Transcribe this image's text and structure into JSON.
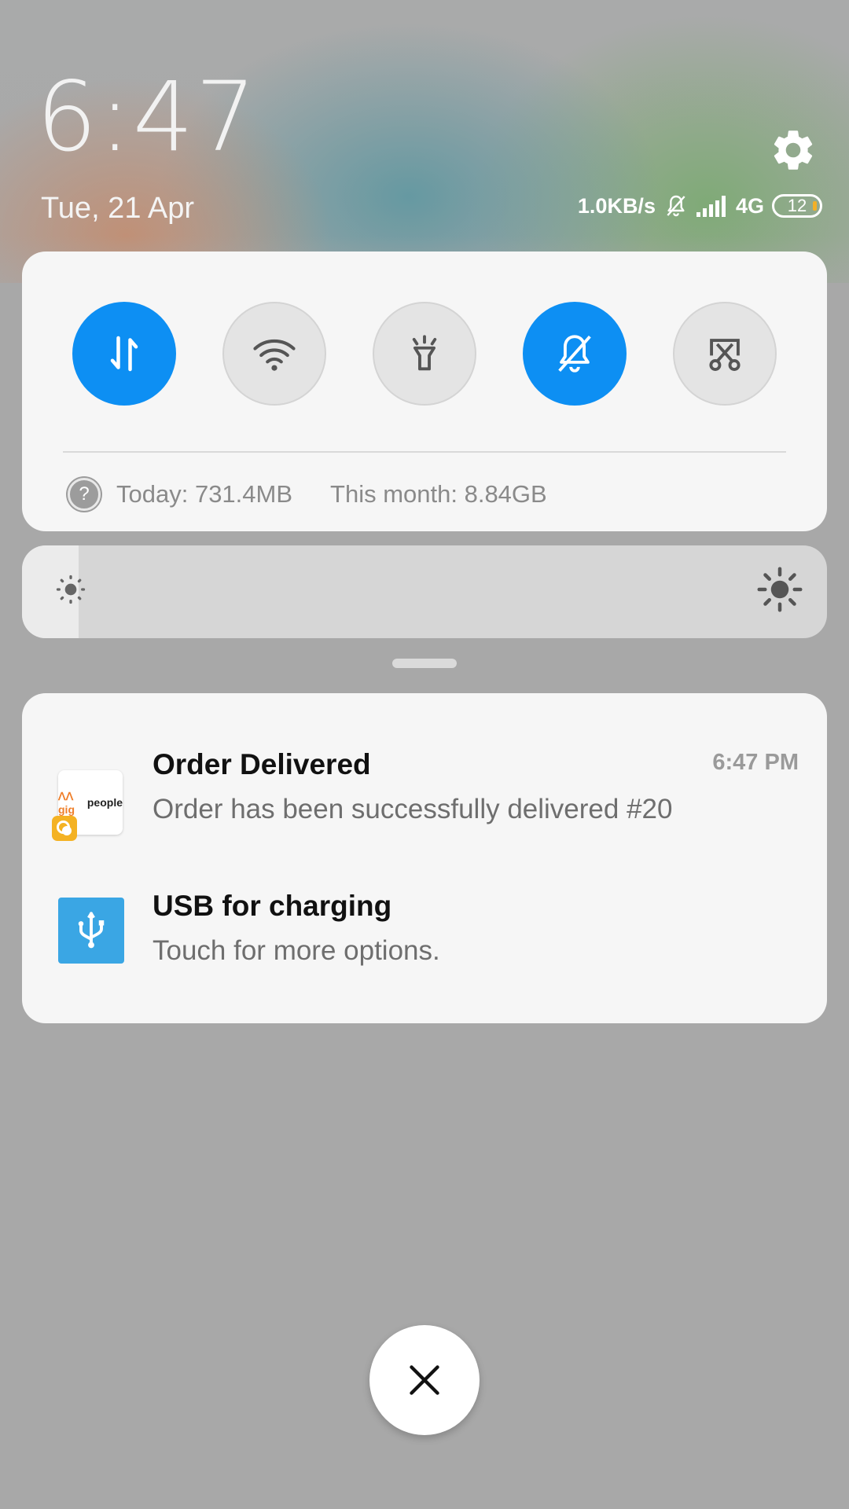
{
  "header": {
    "time": "6:47",
    "date": "Tue, 21 Apr"
  },
  "status_bar": {
    "net_speed": "1.0KB/s",
    "network_type": "4G",
    "battery": "12",
    "icons": [
      "bell-muted-icon",
      "signal-icon",
      "battery-icon"
    ]
  },
  "quick_settings": {
    "toggles": [
      {
        "name": "mobile-data-toggle",
        "icon": "data-arrows-icon",
        "state": "on"
      },
      {
        "name": "wifi-toggle",
        "icon": "wifi-icon",
        "state": "off"
      },
      {
        "name": "flashlight-toggle",
        "icon": "flashlight-icon",
        "state": "off"
      },
      {
        "name": "silent-toggle",
        "icon": "bell-muted-icon",
        "state": "on"
      },
      {
        "name": "screenshot-toggle",
        "icon": "scissors-icon",
        "state": "off"
      }
    ],
    "data_usage": {
      "today": "Today: 731.4MB",
      "month": "This month: 8.84GB"
    }
  },
  "brightness": {
    "level": 0.07
  },
  "notifications": [
    {
      "app": "gigpeople",
      "title": "Order Delivered",
      "text": "Order has been successfully delivered #20",
      "time": "6:47 PM"
    },
    {
      "app": "usb",
      "title": "USB for charging",
      "text": "Touch for more options."
    }
  ],
  "colors": {
    "accent": "#0d8ff3",
    "usb_icon": "#3aa6e4",
    "gig_badge": "#f4b223"
  }
}
